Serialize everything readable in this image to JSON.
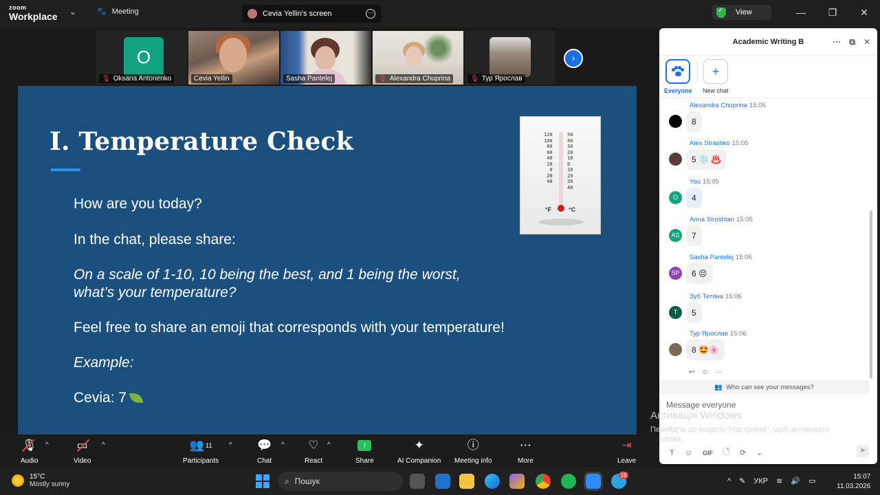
{
  "titlebar": {
    "app_line1": "zoom",
    "app_line2": "Workplace",
    "meeting_tab": "Meeting",
    "screen_tab": "Cevia Yellin's screen",
    "view_btn": "View"
  },
  "participants_strip": [
    {
      "name": "Oksana Antonenko",
      "initial": "O",
      "muted": true
    },
    {
      "name": "Cevia Yellin",
      "muted": false
    },
    {
      "name": "Sasha Pantelej",
      "muted": false,
      "active": true
    },
    {
      "name": "Alexandra Chuprina",
      "muted": true
    },
    {
      "name": "Тур Ярослав",
      "muted": true
    }
  ],
  "slide": {
    "title": "I.  Temperature Check",
    "line1": "How are you today?",
    "line2": "In the chat, please share:",
    "line3a": "On a scale of 1-10, 10 being the best, and 1 being the worst,",
    "line3b": "what’s your temperature?",
    "line4": "Feel free to share an emoji that corresponds with your temperature!",
    "line5": "Example:",
    "line6": "Cevia: 7",
    "thermo_left": [
      "120",
      "100",
      "80",
      "60",
      "40",
      "20",
      "0",
      "20",
      "40"
    ],
    "thermo_right": [
      "50",
      "40",
      "30",
      "20",
      "10",
      "0",
      "10",
      "20",
      "30",
      "40"
    ],
    "thermo_unit_f": "°F",
    "thermo_unit_c": "°C"
  },
  "chat": {
    "title": "Academic Writing B",
    "tab_everyone": "Everyone",
    "tab_newchat": "New chat",
    "messages": [
      {
        "sender": "Alexandra Chuprina",
        "time": "15:05",
        "text": "8",
        "avatar": "",
        "color": "#000000"
      },
      {
        "sender": "Alex Strashko",
        "time": "15:05",
        "text": "5 ❄️ ♨️",
        "avatar": "",
        "color": "#5b3a3a"
      },
      {
        "sender": "You",
        "time": "15:05",
        "text": "4",
        "avatar": "O",
        "color": "#14a37f"
      },
      {
        "sender": "Anna Siroshtan",
        "time": "15:05",
        "text": "7",
        "avatar": "AS",
        "color": "#14a37f"
      },
      {
        "sender": "Sasha Pantelej",
        "time": "15:05",
        "text": "6 😔",
        "avatar": "SP",
        "color": "#8e44ad"
      },
      {
        "sender": "Зуб Тетяна",
        "time": "15:06",
        "text": "5",
        "avatar": "T",
        "color": "#0e5c4b"
      },
      {
        "sender": "Тур Ярослав",
        "time": "15:06",
        "text": "8 🤩🌸",
        "avatar": "",
        "color": "#7a6a5a"
      }
    ],
    "who_can_see": "Who can see your messages?",
    "compose_placeholder": "Message everyone",
    "gif_label": "GIF"
  },
  "activation": {
    "line1": "Активація Windows",
    "line2": "Перейдіть до розділу \"Настройки\", щоб активувати Windows."
  },
  "toolbar": {
    "audio": "Audio",
    "video": "Video",
    "participants": "Participants",
    "participants_count": "11",
    "chat": "Chat",
    "react": "React",
    "share": "Share",
    "ai": "AI Companion",
    "info": "Meeting info",
    "more": "More",
    "leave": "Leave"
  },
  "taskbar": {
    "temp": "15°C",
    "weather": "Mostly sunny",
    "search": "Пошук",
    "lang": "УКР",
    "time": "15:07",
    "date": "11.03.2026",
    "telegram_badge": "16"
  }
}
